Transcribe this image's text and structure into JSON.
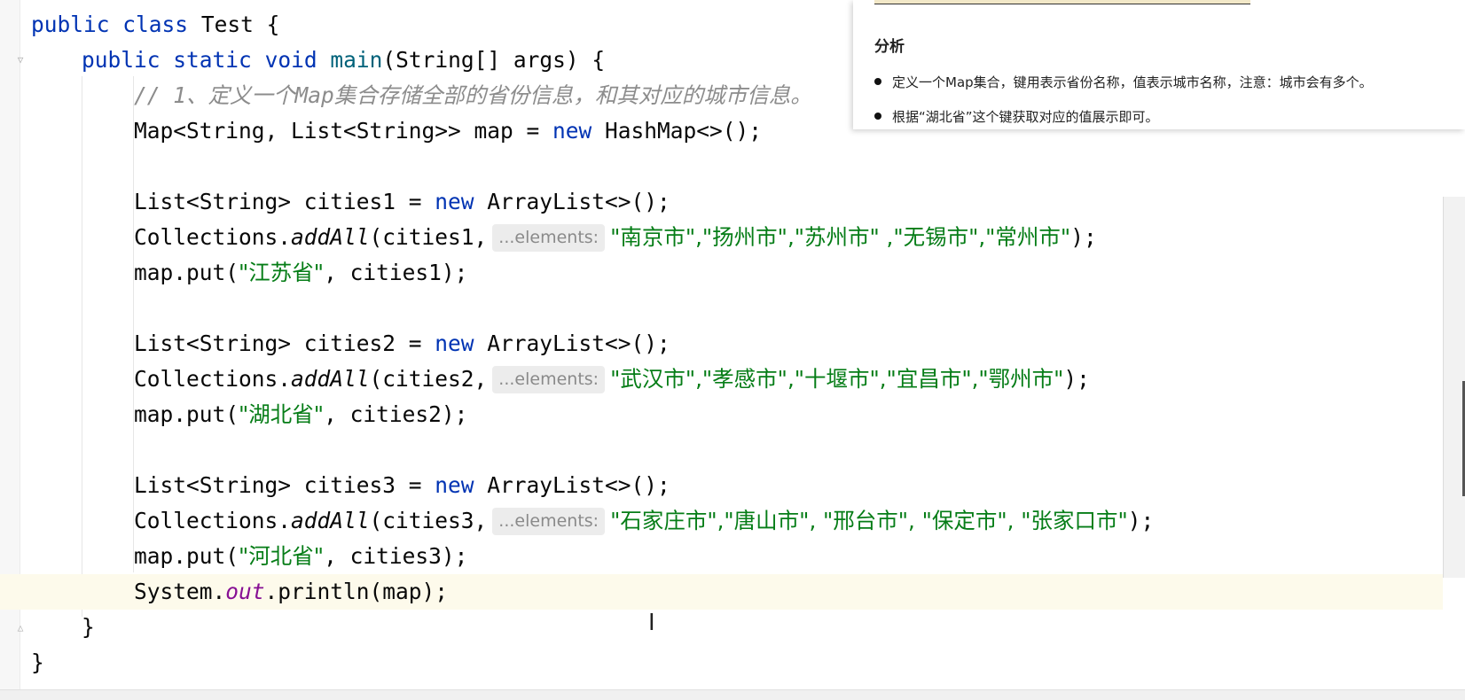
{
  "editor": {
    "lines": {
      "l1": {
        "kw1": "public",
        "kw2": "class",
        "name": "Test",
        "brace": " {"
      },
      "l2": {
        "kw1": "public",
        "kw2": "static",
        "kw3": "void",
        "method": "main",
        "rest": "(String[] args) {"
      },
      "l3": {
        "comment": "// 1、定义一个Map集合存储全部的省份信息，和其对应的城市信息。"
      },
      "l4": {
        "a": "Map<String, List<String>> map = ",
        "kw": "new",
        "b": " HashMap<>();"
      },
      "l6": {
        "a": "List<String> cities1 = ",
        "kw": "new",
        "b": " ArrayList<>();"
      },
      "l7": {
        "a": "Collections.",
        "method": "addAll",
        "b": "(cities1,",
        "hint": "...elements:",
        "args": "\"南京市\",\"扬州市\",\"苏州市\" ,\"无锡市\",\"常州市\"",
        "end": ");"
      },
      "l8": {
        "a": "map.put(",
        "str": "\"江苏省\"",
        "b": ", cities1);"
      },
      "l10": {
        "a": "List<String> cities2 = ",
        "kw": "new",
        "b": " ArrayList<>();"
      },
      "l11": {
        "a": "Collections.",
        "method": "addAll",
        "b": "(cities2,",
        "hint": "...elements:",
        "args": "\"武汉市\",\"孝感市\",\"十堰市\",\"宜昌市\",\"鄂州市\"",
        "end": ");"
      },
      "l12": {
        "a": "map.put(",
        "str": "\"湖北省\"",
        "b": ", cities2);"
      },
      "l14": {
        "a": "List<String> cities3 = ",
        "kw": "new",
        "b": " ArrayList<>();"
      },
      "l15": {
        "a": "Collections.",
        "method": "addAll",
        "b": "(cities3,",
        "hint": "...elements:",
        "args": "\"石家庄市\",\"唐山市\", \"邢台市\", \"保定市\", \"张家口市\"",
        "end": ");"
      },
      "l16": {
        "a": "map.put(",
        "str": "\"河北省\"",
        "b": ", cities3);"
      },
      "l17": {
        "a": "System.",
        "field": "out",
        "b": ".println(map);"
      },
      "l18": {
        "brace": "}"
      },
      "l19": {
        "brace": "}"
      }
    }
  },
  "analysis": {
    "title": "分析",
    "items": [
      "定义一个Map集合，键用表示省份名称，值表示城市名称，注意：城市会有多个。",
      "根据“湖北省”这个键获取对应的值展示即可。"
    ]
  }
}
